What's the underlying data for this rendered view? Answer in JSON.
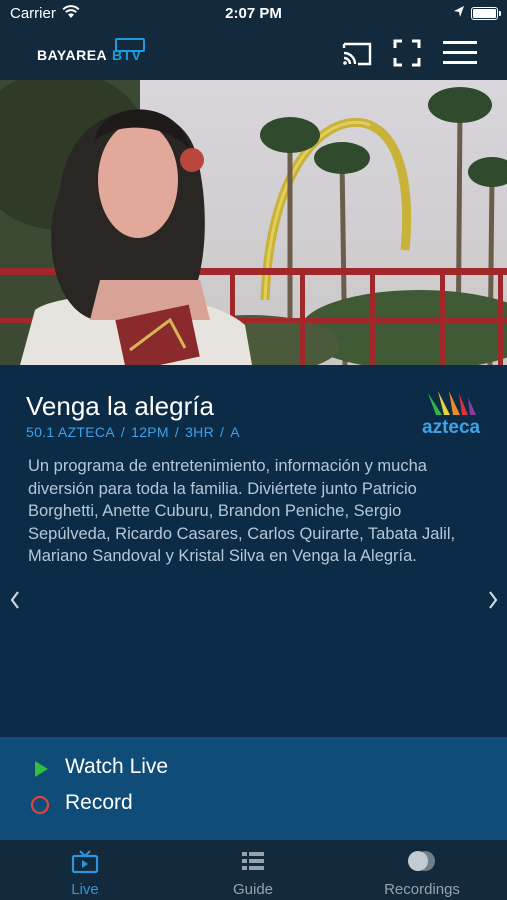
{
  "status_bar": {
    "carrier": "Carrier",
    "time": "2:07 PM"
  },
  "header": {
    "logo_text_part1": "BAYAREA",
    "logo_text_part2": "BTV",
    "icons": [
      "cast-icon",
      "fullscreen-icon",
      "hamburger-menu-icon"
    ]
  },
  "program": {
    "title": "Venga la alegría",
    "channel": "50.1 AZTECA",
    "time": "12PM",
    "duration": "3HR",
    "rating": "A",
    "channel_logo_text": "azteca",
    "description": "Un programa de entretenimiento, información y mucha diversión para toda la familia. Diviértete junto Patricio Borghetti, Anette Cuburu, Brandon Peniche, Sergio Sepúlveda, Ricardo Casares, Carlos Quirarte, Tabata Jalil, Mariano Sandoval y Kristal Silva en Venga la Alegría."
  },
  "actions": {
    "watch_live": "Watch Live",
    "record": "Record"
  },
  "tabs": [
    {
      "label": "Live",
      "icon": "tv-icon",
      "active": true
    },
    {
      "label": "Guide",
      "icon": "guide-list-icon",
      "active": false
    },
    {
      "label": "Recordings",
      "icon": "recordings-icon",
      "active": false
    }
  ],
  "colors": {
    "accent": "#2c95e2",
    "header_bg": "#132a3c",
    "detail_bg": "#0c2b47",
    "actions_bg": "#0f4c77",
    "play_green": "#2fbf3a",
    "record_red": "#e0443e"
  }
}
